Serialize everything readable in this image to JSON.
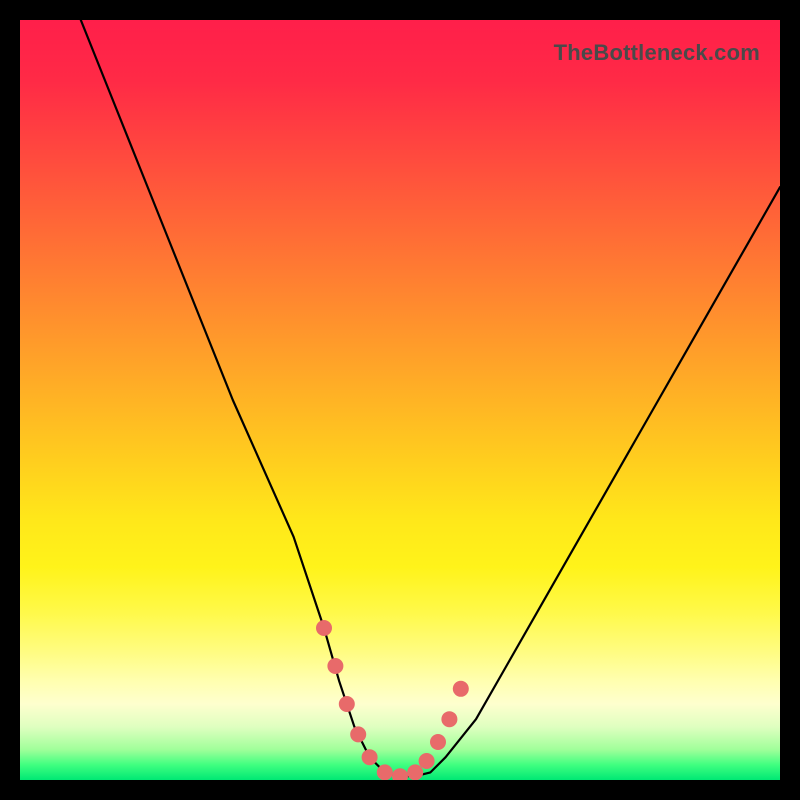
{
  "watermark": "TheBottleneck.com",
  "colors": {
    "frame": "#000000",
    "curve_stroke": "#000000",
    "marker_fill": "#e86a6a",
    "marker_stroke": "#d64f4f"
  },
  "chart_data": {
    "type": "line",
    "title": "",
    "xlabel": "",
    "ylabel": "",
    "xlim": [
      0,
      100
    ],
    "ylim": [
      0,
      100
    ],
    "grid": false,
    "legend": false,
    "note": "No axis ticks or numeric labels are rendered in the image; x/y are normalized 0–100. y≈0 at the flat bottom, y≈100 at the top edge. Curve traced from pixels.",
    "series": [
      {
        "name": "bottleneck-curve",
        "x": [
          8,
          12,
          16,
          20,
          24,
          28,
          32,
          36,
          40,
          42,
          44,
          46,
          48,
          50,
          52,
          54,
          56,
          60,
          64,
          68,
          72,
          76,
          80,
          84,
          88,
          92,
          96,
          100
        ],
        "y": [
          100,
          90,
          80,
          70,
          60,
          50,
          41,
          32,
          20,
          13,
          7,
          3,
          1,
          0.5,
          0.5,
          1,
          3,
          8,
          15,
          22,
          29,
          36,
          43,
          50,
          57,
          64,
          71,
          78
        ]
      }
    ],
    "markers": {
      "name": "highlight-dots",
      "x": [
        40,
        41.5,
        43,
        44.5,
        46,
        48,
        50,
        52,
        53.5,
        55,
        56.5,
        58
      ],
      "y": [
        20,
        15,
        10,
        6,
        3,
        1,
        0.5,
        1,
        2.5,
        5,
        8,
        12
      ]
    }
  }
}
